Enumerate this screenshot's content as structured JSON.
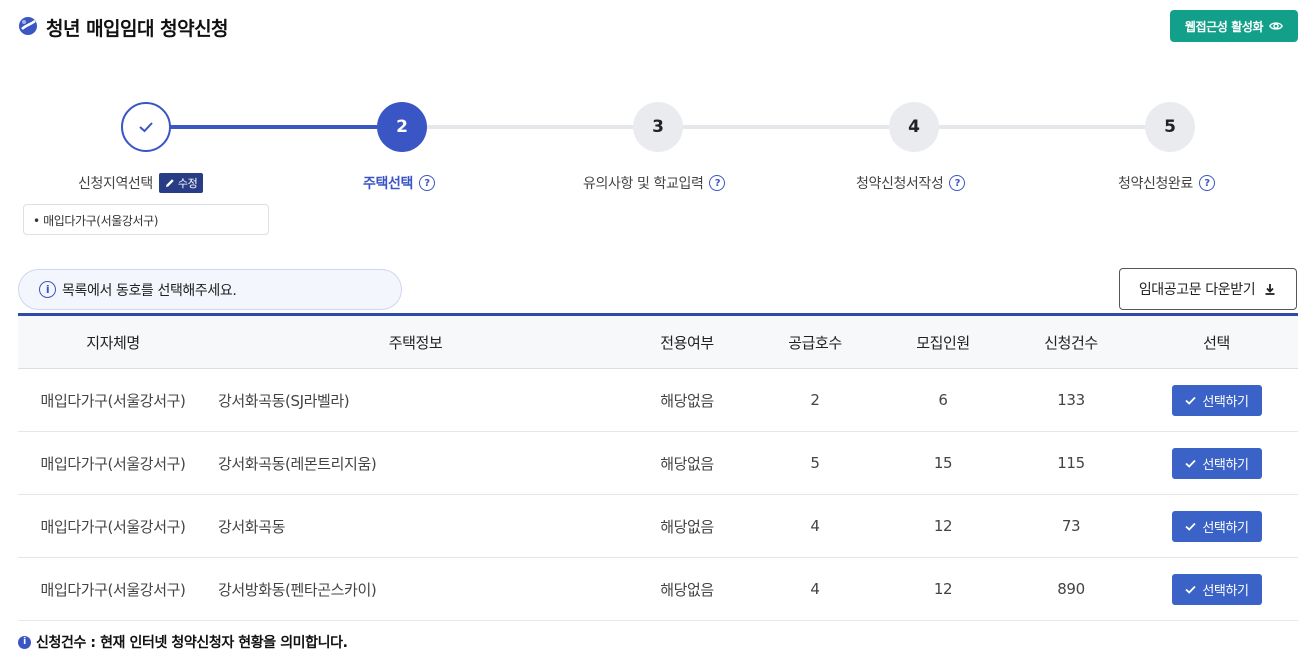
{
  "header": {
    "title": "청년 매입임대 청약신청",
    "accessibility_button": "웹접근성 활성화"
  },
  "stepper": {
    "steps": [
      {
        "number": "✓",
        "label": "신청지역선택",
        "state": "done"
      },
      {
        "number": "2",
        "label": "주택선택",
        "state": "active"
      },
      {
        "number": "3",
        "label": "유의사항 및 학교입력",
        "state": "todo"
      },
      {
        "number": "4",
        "label": "청약신청서작성",
        "state": "todo"
      },
      {
        "number": "5",
        "label": "청약신청완료",
        "state": "todo"
      }
    ],
    "edit_label": "수정",
    "selected_region": "• 매입다가구(서울강서구)"
  },
  "info": {
    "message": "목록에서 동호를 선택해주세요.",
    "download_label": "임대공고문 다운받기"
  },
  "table": {
    "headers": [
      "지자체명",
      "주택정보",
      "전용여부",
      "공급호수",
      "모집인원",
      "신청건수",
      "선택"
    ],
    "select_label": "선택하기",
    "rows": [
      {
        "region": "매입다가구(서울강서구)",
        "house": "강서화곡동(SJ라벨라)",
        "exclusive": "해당없음",
        "supply": "2",
        "recruit": "6",
        "applications": "133"
      },
      {
        "region": "매입다가구(서울강서구)",
        "house": "강서화곡동(레몬트리지움)",
        "exclusive": "해당없음",
        "supply": "5",
        "recruit": "15",
        "applications": "115"
      },
      {
        "region": "매입다가구(서울강서구)",
        "house": "강서화곡동",
        "exclusive": "해당없음",
        "supply": "4",
        "recruit": "12",
        "applications": "73"
      },
      {
        "region": "매입다가구(서울강서구)",
        "house": "강서방화동(펜타곤스카이)",
        "exclusive": "해당없음",
        "supply": "4",
        "recruit": "12",
        "applications": "890"
      }
    ]
  },
  "footnote": "신청건수 : 현재 인터넷 청약신청자 현황을 의미합니다.",
  "colors": {
    "accent": "#3a56c4",
    "button": "#3a62c7",
    "a11y": "#12a08a"
  }
}
